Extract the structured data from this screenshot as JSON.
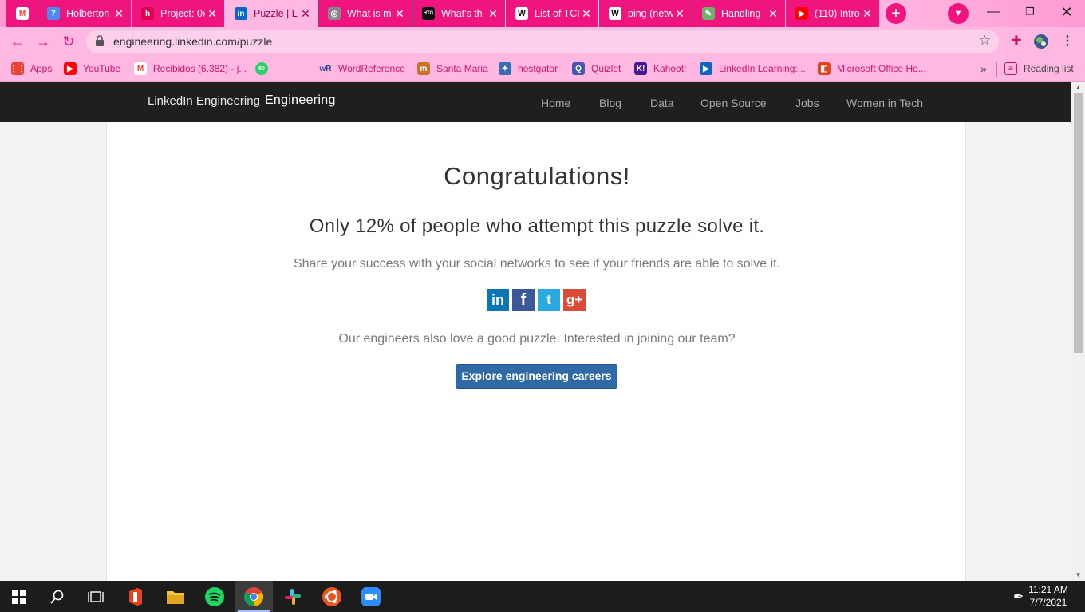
{
  "browser": {
    "tabs": [
      {
        "title": "",
        "icon": "gmail-icon",
        "color": "#ffffff",
        "glyph": "M",
        "glyph_color": "#ea4335"
      },
      {
        "title": "Holberton",
        "icon": "calendar-icon",
        "color": "#4a8af4",
        "glyph": "7"
      },
      {
        "title": "Project: 0x",
        "icon": "holberton-icon",
        "color": "#e0004d",
        "glyph": "h"
      },
      {
        "title": "Puzzle | Li",
        "icon": "linkedin-icon",
        "color": "#0a66c2",
        "glyph": "in"
      },
      {
        "title": "What is m",
        "icon": "globe-icon",
        "color": "#888888",
        "glyph": "◎"
      },
      {
        "title": "What's th",
        "icon": "htg-icon",
        "color": "#111111",
        "glyph": "HTG"
      },
      {
        "title": "List of TCP",
        "icon": "wikipedia-icon",
        "color": "#ffffff",
        "glyph": "W",
        "glyph_color": "#000000"
      },
      {
        "title": "ping (netw",
        "icon": "wikipedia-icon",
        "color": "#ffffff",
        "glyph": "W",
        "glyph_color": "#000000"
      },
      {
        "title": "Handling",
        "icon": "page-icon",
        "color": "#6bb36b",
        "glyph": "✎"
      },
      {
        "title": "(110) Intro",
        "icon": "youtube-icon",
        "color": "#ff0000",
        "glyph": "▶"
      }
    ],
    "url": "engineering.linkedin.com/puzzle",
    "bookmarks": [
      {
        "label": "Apps",
        "icon": "apps-grid-icon"
      },
      {
        "label": "YouTube",
        "icon": "youtube-icon"
      },
      {
        "label": "Recibidos (6.382) - j...",
        "icon": "gmail-icon"
      },
      {
        "label": "",
        "icon": "whatsapp-icon"
      },
      {
        "label": "WordReference",
        "icon": "wordreference-icon"
      },
      {
        "label": "Santa Maria",
        "icon": "santa-maria-icon"
      },
      {
        "label": "hostgator",
        "icon": "hostgator-icon"
      },
      {
        "label": "Quizlet",
        "icon": "quizlet-icon"
      },
      {
        "label": "Kahoot!",
        "icon": "kahoot-icon"
      },
      {
        "label": "LinkedIn Learning:...",
        "icon": "linkedin-learning-icon"
      },
      {
        "label": "Microsoft Office Ho...",
        "icon": "office-icon"
      }
    ],
    "overflow_label": "»",
    "reading_list_label": "Reading list",
    "theme_colors": {
      "tab": "#f0157e",
      "active_tab": "#ffb8e2"
    }
  },
  "site": {
    "logo_alt": "LinkedIn Engineering",
    "brand": "Engineering",
    "nav": [
      "Home",
      "Blog",
      "Data",
      "Open Source",
      "Jobs",
      "Women in Tech"
    ]
  },
  "page": {
    "heading": "Congratulations!",
    "subheading": "Only 12% of people who attempt this puzzle solve it.",
    "share_text": "Share your success with your social networks to see if your friends are able to solve it.",
    "social": [
      {
        "name": "linkedin",
        "glyph": "in",
        "color": "#0b76b4"
      },
      {
        "name": "facebook",
        "glyph": "f",
        "color": "#3b5998"
      },
      {
        "name": "twitter",
        "glyph": "t",
        "color": "#2aa9e0"
      },
      {
        "name": "google-plus",
        "glyph": "g+",
        "color": "#dc4a38"
      }
    ],
    "recruit_text": "Our engineers also love a good puzzle. Interested in joining our team?",
    "cta_label": "Explore engineering careers",
    "cta_color": "#2f6aa4"
  },
  "taskbar": {
    "apps": [
      "windows-start-icon",
      "search-icon",
      "task-view-icon",
      "office-icon",
      "file-explorer-icon",
      "spotify-icon",
      "chrome-icon",
      "slack-icon",
      "ubuntu-icon",
      "zoom-icon"
    ],
    "time": "11:21 AM",
    "date": "7/7/2021"
  }
}
